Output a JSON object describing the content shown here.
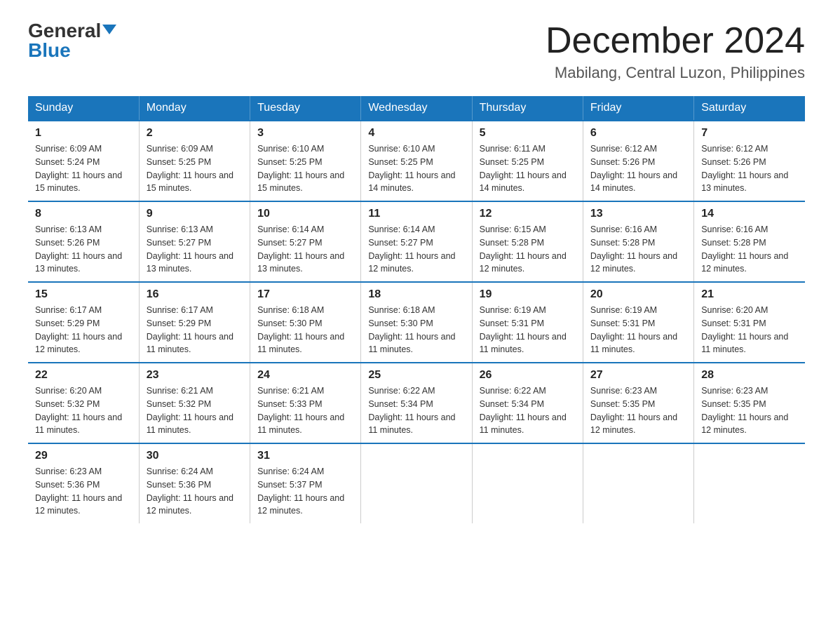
{
  "logo": {
    "general": "General",
    "blue": "Blue"
  },
  "title": "December 2024",
  "location": "Mabilang, Central Luzon, Philippines",
  "days_of_week": [
    "Sunday",
    "Monday",
    "Tuesday",
    "Wednesday",
    "Thursday",
    "Friday",
    "Saturday"
  ],
  "weeks": [
    [
      {
        "day": "1",
        "sunrise": "6:09 AM",
        "sunset": "5:24 PM",
        "daylight": "11 hours and 15 minutes."
      },
      {
        "day": "2",
        "sunrise": "6:09 AM",
        "sunset": "5:25 PM",
        "daylight": "11 hours and 15 minutes."
      },
      {
        "day": "3",
        "sunrise": "6:10 AM",
        "sunset": "5:25 PM",
        "daylight": "11 hours and 15 minutes."
      },
      {
        "day": "4",
        "sunrise": "6:10 AM",
        "sunset": "5:25 PM",
        "daylight": "11 hours and 14 minutes."
      },
      {
        "day": "5",
        "sunrise": "6:11 AM",
        "sunset": "5:25 PM",
        "daylight": "11 hours and 14 minutes."
      },
      {
        "day": "6",
        "sunrise": "6:12 AM",
        "sunset": "5:26 PM",
        "daylight": "11 hours and 14 minutes."
      },
      {
        "day": "7",
        "sunrise": "6:12 AM",
        "sunset": "5:26 PM",
        "daylight": "11 hours and 13 minutes."
      }
    ],
    [
      {
        "day": "8",
        "sunrise": "6:13 AM",
        "sunset": "5:26 PM",
        "daylight": "11 hours and 13 minutes."
      },
      {
        "day": "9",
        "sunrise": "6:13 AM",
        "sunset": "5:27 PM",
        "daylight": "11 hours and 13 minutes."
      },
      {
        "day": "10",
        "sunrise": "6:14 AM",
        "sunset": "5:27 PM",
        "daylight": "11 hours and 13 minutes."
      },
      {
        "day": "11",
        "sunrise": "6:14 AM",
        "sunset": "5:27 PM",
        "daylight": "11 hours and 12 minutes."
      },
      {
        "day": "12",
        "sunrise": "6:15 AM",
        "sunset": "5:28 PM",
        "daylight": "11 hours and 12 minutes."
      },
      {
        "day": "13",
        "sunrise": "6:16 AM",
        "sunset": "5:28 PM",
        "daylight": "11 hours and 12 minutes."
      },
      {
        "day": "14",
        "sunrise": "6:16 AM",
        "sunset": "5:28 PM",
        "daylight": "11 hours and 12 minutes."
      }
    ],
    [
      {
        "day": "15",
        "sunrise": "6:17 AM",
        "sunset": "5:29 PM",
        "daylight": "11 hours and 12 minutes."
      },
      {
        "day": "16",
        "sunrise": "6:17 AM",
        "sunset": "5:29 PM",
        "daylight": "11 hours and 11 minutes."
      },
      {
        "day": "17",
        "sunrise": "6:18 AM",
        "sunset": "5:30 PM",
        "daylight": "11 hours and 11 minutes."
      },
      {
        "day": "18",
        "sunrise": "6:18 AM",
        "sunset": "5:30 PM",
        "daylight": "11 hours and 11 minutes."
      },
      {
        "day": "19",
        "sunrise": "6:19 AM",
        "sunset": "5:31 PM",
        "daylight": "11 hours and 11 minutes."
      },
      {
        "day": "20",
        "sunrise": "6:19 AM",
        "sunset": "5:31 PM",
        "daylight": "11 hours and 11 minutes."
      },
      {
        "day": "21",
        "sunrise": "6:20 AM",
        "sunset": "5:31 PM",
        "daylight": "11 hours and 11 minutes."
      }
    ],
    [
      {
        "day": "22",
        "sunrise": "6:20 AM",
        "sunset": "5:32 PM",
        "daylight": "11 hours and 11 minutes."
      },
      {
        "day": "23",
        "sunrise": "6:21 AM",
        "sunset": "5:32 PM",
        "daylight": "11 hours and 11 minutes."
      },
      {
        "day": "24",
        "sunrise": "6:21 AM",
        "sunset": "5:33 PM",
        "daylight": "11 hours and 11 minutes."
      },
      {
        "day": "25",
        "sunrise": "6:22 AM",
        "sunset": "5:34 PM",
        "daylight": "11 hours and 11 minutes."
      },
      {
        "day": "26",
        "sunrise": "6:22 AM",
        "sunset": "5:34 PM",
        "daylight": "11 hours and 11 minutes."
      },
      {
        "day": "27",
        "sunrise": "6:23 AM",
        "sunset": "5:35 PM",
        "daylight": "11 hours and 12 minutes."
      },
      {
        "day": "28",
        "sunrise": "6:23 AM",
        "sunset": "5:35 PM",
        "daylight": "11 hours and 12 minutes."
      }
    ],
    [
      {
        "day": "29",
        "sunrise": "6:23 AM",
        "sunset": "5:36 PM",
        "daylight": "11 hours and 12 minutes."
      },
      {
        "day": "30",
        "sunrise": "6:24 AM",
        "sunset": "5:36 PM",
        "daylight": "11 hours and 12 minutes."
      },
      {
        "day": "31",
        "sunrise": "6:24 AM",
        "sunset": "5:37 PM",
        "daylight": "11 hours and 12 minutes."
      },
      null,
      null,
      null,
      null
    ]
  ]
}
